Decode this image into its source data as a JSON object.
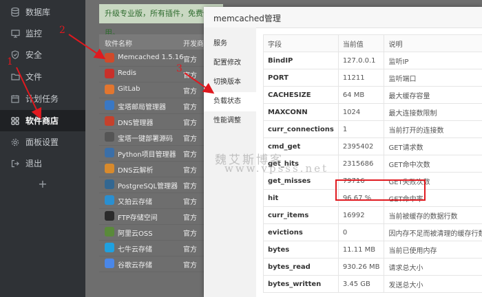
{
  "sidebar": {
    "items": [
      {
        "label": "数据库",
        "icon": "database-icon"
      },
      {
        "label": "监控",
        "icon": "monitor-icon"
      },
      {
        "label": "安全",
        "icon": "shield-icon"
      },
      {
        "label": "文件",
        "icon": "folder-icon"
      },
      {
        "label": "计划任务",
        "icon": "clock-icon"
      },
      {
        "label": "软件商店",
        "icon": "grid-icon"
      },
      {
        "label": "面板设置",
        "icon": "gear-icon"
      },
      {
        "label": "退出",
        "icon": "logout-icon"
      }
    ],
    "add_label": "+"
  },
  "upgrade_banner": "升级专业版，所有插件，免费使用。",
  "plugin_list": {
    "columns": [
      "软件名称",
      "开发商"
    ],
    "rows": [
      {
        "name": "Memcached 1.5.16",
        "dev": "官方",
        "color": "#d04a2a"
      },
      {
        "name": "Redis",
        "dev": "官方",
        "color": "#c8302a"
      },
      {
        "name": "GitLab",
        "dev": "官方",
        "color": "#e2762f"
      },
      {
        "name": "宝塔邮局管理器",
        "dev": "官方",
        "color": "#3a78c4"
      },
      {
        "name": "DNS管理器",
        "dev": "官方",
        "color": "#c5412c"
      },
      {
        "name": "宝塔一键部署源码",
        "dev": "官方",
        "color": "#555555"
      },
      {
        "name": "Python项目管理器",
        "dev": "官方",
        "color": "#3b6fa8"
      },
      {
        "name": "DNS云解析",
        "dev": "官方",
        "color": "#d88a2c"
      },
      {
        "name": "PostgreSQL管理器",
        "dev": "官方",
        "color": "#336791"
      },
      {
        "name": "又拍云存储",
        "dev": "官方",
        "color": "#2a8fd0"
      },
      {
        "name": "FTP存储空间",
        "dev": "官方",
        "color": "#2b2b2b"
      },
      {
        "name": "阿里云OSS",
        "dev": "官方",
        "color": "#5a8a3a"
      },
      {
        "name": "七牛云存储",
        "dev": "官方",
        "color": "#1fa1e0"
      },
      {
        "name": "谷歌云存储",
        "dev": "官方",
        "color": "#4a87e8"
      }
    ]
  },
  "modal": {
    "title": "memcached管理",
    "tabs": [
      "服务",
      "配置修改",
      "切换版本",
      "负载状态",
      "性能调整"
    ],
    "active_tab": 3,
    "table": {
      "headers": [
        "字段",
        "当前值",
        "说明"
      ],
      "rows": [
        {
          "field": "BindIP",
          "value": "127.0.0.1",
          "desc": "监听IP"
        },
        {
          "field": "PORT",
          "value": "11211",
          "desc": "监听端口"
        },
        {
          "field": "CACHESIZE",
          "value": "64 MB",
          "desc": "最大缓存容量"
        },
        {
          "field": "MAXCONN",
          "value": "1024",
          "desc": "最大连接数限制"
        },
        {
          "field": "curr_connections",
          "value": "1",
          "desc": "当前打开的连接数"
        },
        {
          "field": "cmd_get",
          "value": "2395402",
          "desc": "GET请求数"
        },
        {
          "field": "get_hits",
          "value": "2315686",
          "desc": "GET命中次数"
        },
        {
          "field": "get_misses",
          "value": "79716",
          "desc": "GET失败次数"
        },
        {
          "field": "hit",
          "value": "96.67 %",
          "desc": "GET命中率"
        },
        {
          "field": "curr_items",
          "value": "16992",
          "desc": "当前被缓存的数据行数"
        },
        {
          "field": "evictions",
          "value": "0",
          "desc": "因内存不足而被清理的缓存行数"
        },
        {
          "field": "bytes",
          "value": "11.11 MB",
          "desc": "当前已使用内存"
        },
        {
          "field": "bytes_read",
          "value": "930.26 MB",
          "desc": "请求总大小"
        },
        {
          "field": "bytes_written",
          "value": "3.45 GB",
          "desc": "发送总大小"
        }
      ]
    }
  },
  "annotations": [
    "1",
    "2",
    "3"
  ],
  "watermark": {
    "line1": "魏艾斯博客",
    "line2": "www.vpsss.net"
  },
  "colors": {
    "annotation_red": "#e0191f",
    "sidebar_bg": "#2f3236",
    "active_bg": "#1f2124"
  }
}
